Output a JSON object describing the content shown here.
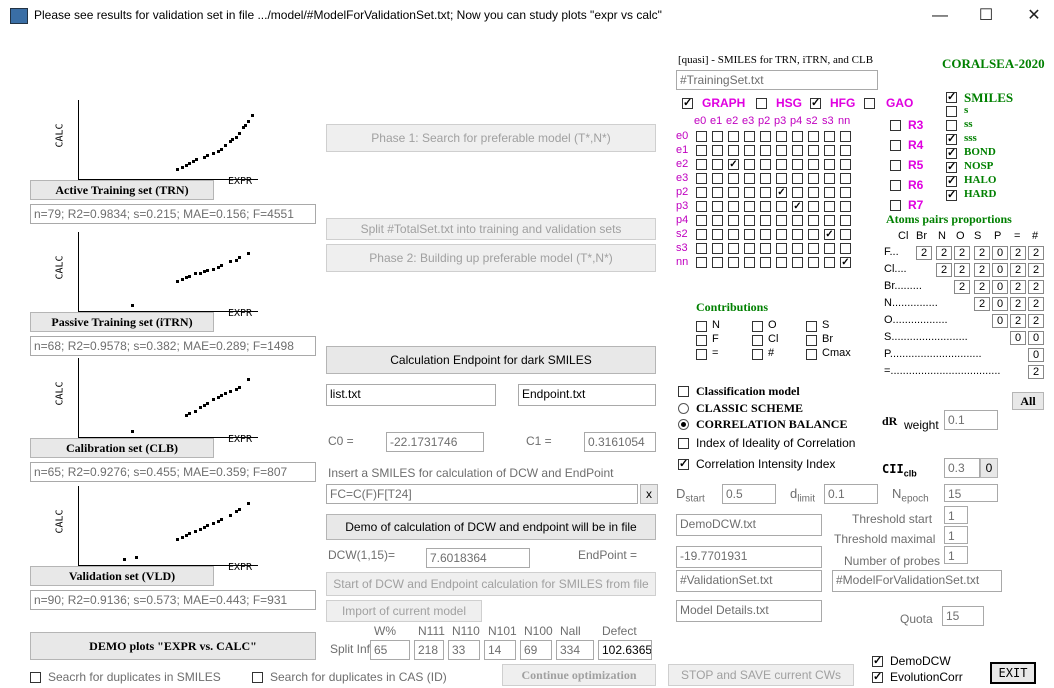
{
  "window": {
    "title": "Please see results for validation set in file .../model/#ModelForValidationSet.txt; Now you can study plots \"expr vs calc\"",
    "min": "—",
    "max": "☐",
    "close": "✕"
  },
  "plots": [
    {
      "xlabel": "EXPR",
      "ylabel": "CALC",
      "button": "Active Training set (TRN)",
      "stats": "n=79; R2=0.9834; s=0.215; MAE=0.156; F=4551"
    },
    {
      "xlabel": "EXPR",
      "ylabel": "CALC",
      "button": "Passive Training set (iTRN)",
      "stats": "n=68; R2=0.9578; s=0.382; MAE=0.289; F=1498"
    },
    {
      "xlabel": "EXPR",
      "ylabel": "CALC",
      "button": "Calibration set (CLB)",
      "stats": "n=65; R2=0.9276; s=0.455; MAE=0.359; F=807"
    },
    {
      "xlabel": "EXPR",
      "ylabel": "CALC",
      "button": "Validation set (VLD)",
      "stats": "n=90; R2=0.9136; s=0.573; MAE=0.443; F=931"
    }
  ],
  "demo_plots_button": "DEMO plots \"EXPR vs. CALC\"",
  "dup_smiles": "Seacrh for duplicates in SMILES",
  "dup_cas": "Search for duplicates in CAS (ID)",
  "middle": {
    "phase1": "Phase 1: Search for preferable model (T*,N*)",
    "split": "Split #TotalSet.txt into training and validation sets",
    "phase2": "Phase 2: Building up preferable model (T*,N*)",
    "calc_endpoint": "Calculation Endpoint for dark SMILES",
    "list_file": "list.txt",
    "endpoint_file": "Endpoint.txt",
    "c0_label": "C0 =",
    "c0_value": "-22.1731746",
    "c1_label": "C1 =",
    "c1_value": "0.3161054",
    "insert_label": "Insert a SMILES for calculation of DCW and EndPoint",
    "smiles_value": "FC=C(F)F[T24]",
    "x_button": "x",
    "demo_button": "Demo of calculation of DCW and endpoint will be in file",
    "dcw_label": "DCW(1,15)=",
    "dcw_value": "7.6018364",
    "endpoint_label": "EndPoint =",
    "start_dcw": "Start of DCW and Endpoint calculation for SMILES from file",
    "import_model": "Import of current model",
    "split_info_label": "Split Info",
    "split_headers": [
      "W%",
      "N111",
      "N110",
      "N101",
      "N100",
      "Nall",
      "Defect"
    ],
    "split_values": [
      "65",
      "218",
      "33",
      "14",
      "69",
      "334",
      "102.6365"
    ],
    "continue_opt": "Continue optimization",
    "stop_save": "STOP and SAVE current CWs"
  },
  "right": {
    "quasi_label": "[quasi] - SMILES  for TRN, iTRN, and CLB",
    "training_file": "#TrainingSet.txt",
    "brand": "CORALSEA-2020",
    "graph": "GRAPH",
    "hsg": "HSG",
    "hfg": "HFG",
    "gao": "GAO",
    "col_headers": [
      "e0",
      "e1",
      "e2",
      "e3",
      "p2",
      "p3",
      "p4",
      "s2",
      "s3",
      "nn"
    ],
    "row_headers": [
      "e0",
      "e1",
      "e2",
      "e3",
      "p2",
      "p3",
      "p4",
      "s2",
      "s3",
      "nn"
    ],
    "r_labels": [
      "R3",
      "R4",
      "R5",
      "R6",
      "R7"
    ],
    "smiles_opts": [
      "SMILES",
      "s",
      "ss",
      "sss",
      "BOND",
      "NOSP",
      "HALO",
      "HARD"
    ],
    "atoms_pairs": "Atoms pairs proportions",
    "pair_headers": [
      "Cl",
      "Br",
      "N",
      "O",
      "S",
      "P",
      "=",
      "#"
    ],
    "pair_rows": [
      {
        "label": "F...",
        "vals": [
          "2",
          "2",
          "2",
          "2",
          "0",
          "2",
          "2"
        ]
      },
      {
        "label": "Cl....",
        "vals": [
          "2",
          "2",
          "2",
          "0",
          "2",
          "2"
        ]
      },
      {
        "label": "Br.........",
        "vals": [
          "2",
          "2",
          "0",
          "2",
          "2"
        ]
      },
      {
        "label": "N...............",
        "vals": [
          "2",
          "0",
          "2",
          "2"
        ]
      },
      {
        "label": "O..................",
        "vals": [
          "0",
          "2",
          "2"
        ]
      },
      {
        "label": "S.........................",
        "vals": [
          "0",
          "0"
        ]
      },
      {
        "label": "P..............................",
        "vals": [
          "0"
        ]
      },
      {
        "label": "=....................................",
        "vals": [
          "2"
        ]
      }
    ],
    "all_button": "All",
    "contributions": "Contributions",
    "contrib_items": [
      "N",
      "O",
      "S",
      "F",
      "Cl",
      "Br",
      "=",
      "#",
      "Cmax"
    ],
    "classification": "Classification model",
    "classic": "CLASSIC SCHEME",
    "corr_balance": "CORRELATION BALANCE",
    "iic": "Index of Ideality of Correlation",
    "cii": "Correlation Intensity Index",
    "dr_label": "dR",
    "weight_label": "weight",
    "weight_value": "0.1",
    "cii_clb": "CII",
    "cii_sub": "clb",
    "cii_value": "0.3",
    "cii_btn": "0",
    "dstart_label": "D",
    "dstart_sub": "start",
    "dstart_value": "0.5",
    "dlimit_label": "d",
    "dlimit_sub": "limit",
    "dlimit_value": "0.1",
    "nepoch_label": "N",
    "nepoch_sub": "epoch",
    "nepoch_value": "15",
    "demo_dcw_file": "DemoDCW.txt",
    "thr_start_label": "Threshold start",
    "thr_start_value": "1",
    "thr_max_label": "Threshold maximal",
    "thr_max_value": "1",
    "neg_value": "-19.7701931",
    "probes_label": "Number of probes",
    "probes_value": "1",
    "validation_file": "#ValidationSet.txt",
    "model_valid_file": "#ModelForValidationSet.txt",
    "model_details": "Model Details.txt",
    "quota_label": "Quota",
    "quota_value": "15",
    "demo_dcw_cb": "DemoDCW",
    "evolution_cb": "EvolutionCorr",
    "exit": "EXIT"
  }
}
